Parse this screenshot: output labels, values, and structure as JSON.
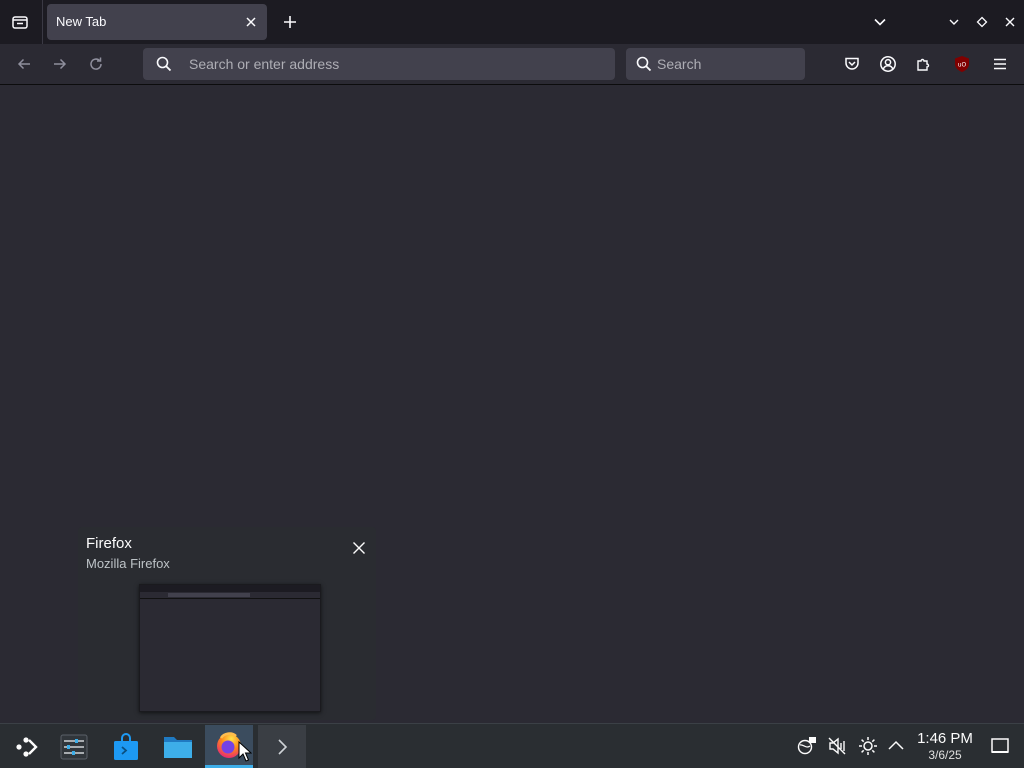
{
  "browser": {
    "tab": {
      "title": "New Tab"
    },
    "urlbar": {
      "placeholder": "Search or enter address"
    },
    "searchbar": {
      "placeholder": "Search"
    }
  },
  "preview": {
    "title": "Firefox",
    "subtitle": "Mozilla Firefox"
  },
  "taskbar": {
    "clock": {
      "time": "1:46 PM",
      "date": "3/6/25"
    },
    "apps": [
      "application-launcher",
      "system-settings",
      "discover",
      "dolphin-file-manager",
      "firefox",
      "konsole-terminal"
    ]
  },
  "colors": {
    "window_bg": "#2b2a33",
    "tabstrip_bg": "#1c1b22",
    "field_bg": "#42414d",
    "taskbar_bg": "#2a2e32",
    "accent": "#3daee9",
    "ublock_red": "#800000"
  },
  "icons": [
    "tab-list-icon",
    "close-icon",
    "plus-icon",
    "chevron-down-icon",
    "minimize-icon",
    "maximize-icon",
    "back-icon",
    "forward-icon",
    "reload-icon",
    "search-icon",
    "pocket-icon",
    "account-icon",
    "extensions-icon",
    "ublock-icon",
    "menu-icon",
    "network-icon",
    "volume-muted-icon",
    "brightness-icon",
    "tray-expand-icon",
    "show-desktop-icon"
  ]
}
